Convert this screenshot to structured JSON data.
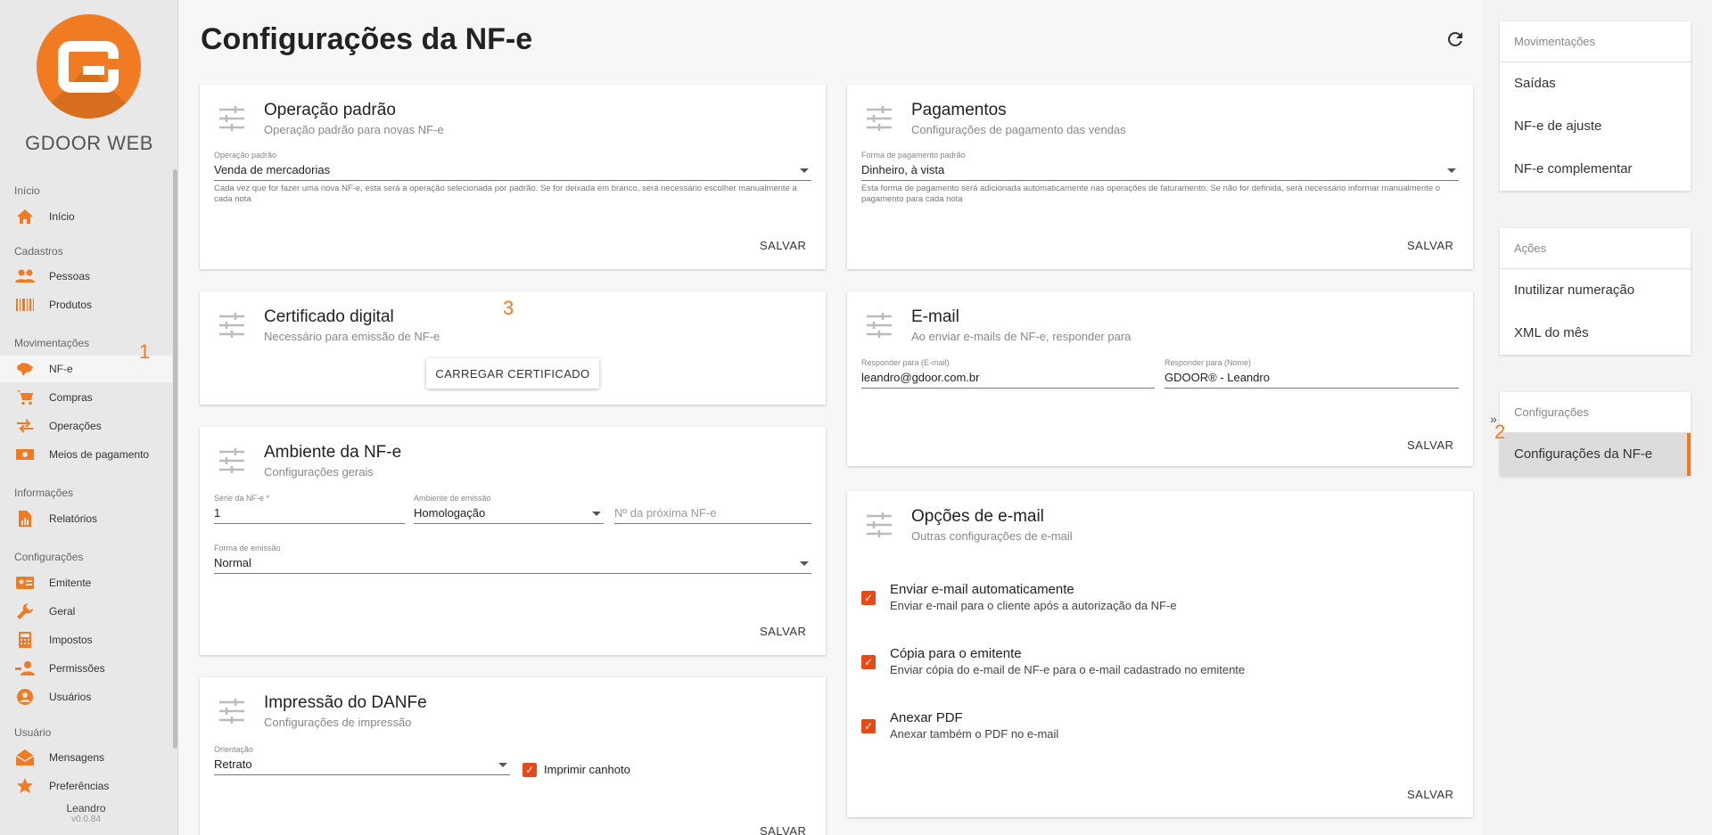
{
  "sidebar": {
    "brand": "GDOOR WEB",
    "sections": [
      {
        "label": "Início",
        "items": [
          {
            "label": "Início",
            "icon": "home-icon"
          }
        ]
      },
      {
        "label": "Cadastros",
        "items": [
          {
            "label": "Pessoas",
            "icon": "people-icon"
          },
          {
            "label": "Produtos",
            "icon": "barcode-icon"
          }
        ]
      },
      {
        "label": "Movimentações",
        "items": [
          {
            "label": "NF-e",
            "icon": "brazil-map-icon"
          },
          {
            "label": "Compras",
            "icon": "cart-icon"
          },
          {
            "label": "Operações",
            "icon": "swap-icon"
          },
          {
            "label": "Meios de pagamento",
            "icon": "money-icon"
          }
        ]
      },
      {
        "label": "Informações",
        "items": [
          {
            "label": "Relatórios",
            "icon": "report-icon"
          }
        ]
      },
      {
        "label": "Configurações",
        "items": [
          {
            "label": "Emitente",
            "icon": "id-card-icon"
          },
          {
            "label": "Geral",
            "icon": "wrench-icon"
          },
          {
            "label": "Impostos",
            "icon": "calculator-icon"
          },
          {
            "label": "Permissões",
            "icon": "permissions-icon"
          },
          {
            "label": "Usuários",
            "icon": "user-circle-icon"
          }
        ]
      },
      {
        "label": "Usuário",
        "items": [
          {
            "label": "Mensagens",
            "icon": "mail-open-icon"
          },
          {
            "label": "Preferências",
            "icon": "star-icon"
          }
        ]
      }
    ],
    "active_item": "NF-e",
    "user": "Leandro",
    "version": "v0.0.84"
  },
  "annotations": {
    "one": "1",
    "two": "2",
    "three": "3"
  },
  "page": {
    "title": "Configurações da NF-e"
  },
  "cards": {
    "operacao": {
      "title": "Operação padrão",
      "subtitle": "Operação padrão para novas NF-e",
      "field_label": "Operação padrão",
      "field_value": "Venda de mercadorias",
      "help": "Cada vez que for fazer uma nova NF-e, esta será a operação selecionada por padrão. Se for deixada em branco, será necessário escolher manualmente a cada nota",
      "save": "SALVAR"
    },
    "pagamentos": {
      "title": "Pagamentos",
      "subtitle": "Configurações de pagamento das vendas",
      "field_label": "Forma de pagamento padrão",
      "field_value": "Dinheiro, à vista",
      "help": "Esta forma de pagamento será adicionada automaticamente nas operações de faturamento. Se não for definida, será necessário informar manualmente o pagamento para cada nota",
      "save": "SALVAR"
    },
    "certificado": {
      "title": "Certificado digital",
      "subtitle": "Necessário para emissão de NF-e",
      "button": "CARREGAR CERTIFICADO"
    },
    "email": {
      "title": "E-mail",
      "subtitle": "Ao enviar e-mails de NF-e, responder para",
      "reply_email_label": "Responder para (E-mail)",
      "reply_email_value": "leandro@gdoor.com.br",
      "reply_name_label": "Responder para (Nome)",
      "reply_name_value": "GDOOR® - Leandro",
      "save": "SALVAR"
    },
    "ambiente": {
      "title": "Ambiente da NF-e",
      "subtitle": "Configurações gerais",
      "serie_label": "Série da NF-e *",
      "serie_value": "1",
      "ambiente_label": "Ambiente de emissão",
      "ambiente_value": "Homologação",
      "proxima_placeholder": "Nº da próxima NF-e",
      "forma_label": "Forma de emissão",
      "forma_value": "Normal",
      "save": "SALVAR"
    },
    "opcoes_email": {
      "title": "Opções de e-mail",
      "subtitle": "Outras configurações de e-mail",
      "options": [
        {
          "title": "Enviar e-mail automaticamente",
          "desc": "Enviar e-mail para o cliente após a autorização da NF-e",
          "checked": true
        },
        {
          "title": "Cópia para o emitente",
          "desc": "Enviar cópia do e-mail de NF-e para o e-mail cadastrado no emitente",
          "checked": true
        },
        {
          "title": "Anexar PDF",
          "desc": "Anexar também o PDF no e-mail",
          "checked": true
        }
      ],
      "save": "SALVAR"
    },
    "danfe": {
      "title": "Impressão do DANFe",
      "subtitle": "Configurações de impressão",
      "orientacao_label": "Orientação",
      "orientacao_value": "Retrato",
      "canhoto_label": "Imprimir canhoto",
      "canhoto_checked": true,
      "save": "SALVAR"
    }
  },
  "right_panel": {
    "movimentacoes": {
      "heading": "Movimentações",
      "items": [
        "Saídas",
        "NF-e de ajuste",
        "NF-e complementar"
      ]
    },
    "acoes": {
      "heading": "Ações",
      "items": [
        "Inutilizar numeração",
        "XML do mês"
      ]
    },
    "configuracoes": {
      "heading": "Configurações",
      "items": [
        "Configurações da NF-e"
      ]
    },
    "collapse_glyph": "»"
  },
  "colors": {
    "accent": "#f07b22",
    "checkbox": "#e64a19"
  }
}
